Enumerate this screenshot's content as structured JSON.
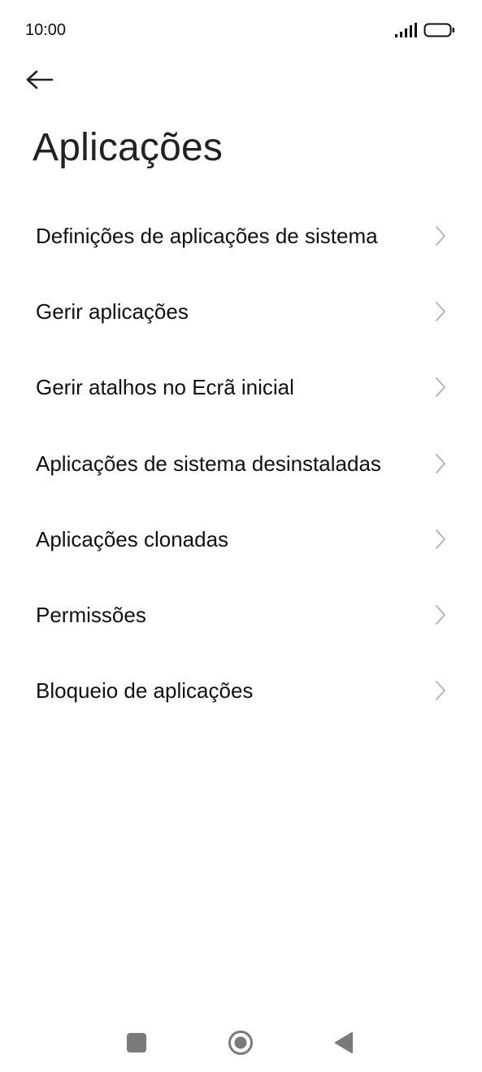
{
  "status_bar": {
    "time": "10:00",
    "signal_icon": "signal-strength-icon",
    "battery_icon": "battery-icon"
  },
  "header": {
    "back_icon": "arrow-left-icon",
    "title": "Aplicações"
  },
  "menu": {
    "items": [
      {
        "label": "Definições de aplicações de sistema"
      },
      {
        "label": "Gerir aplicações"
      },
      {
        "label": "Gerir atalhos no Ecrã inicial"
      },
      {
        "label": "Aplicações de sistema desinstaladas"
      },
      {
        "label": "Aplicações clonadas"
      },
      {
        "label": "Permissões"
      },
      {
        "label": "Bloqueio de aplicações"
      }
    ],
    "chevron_icon": "chevron-right-icon"
  },
  "nav_bar": {
    "recents_icon": "square-recents-icon",
    "home_icon": "circle-home-icon",
    "back_icon": "triangle-back-icon"
  },
  "colors": {
    "background": "#ffffff",
    "text": "#111111",
    "chevron": "#b5b5b5",
    "nav_icon": "#7a7a7a"
  }
}
